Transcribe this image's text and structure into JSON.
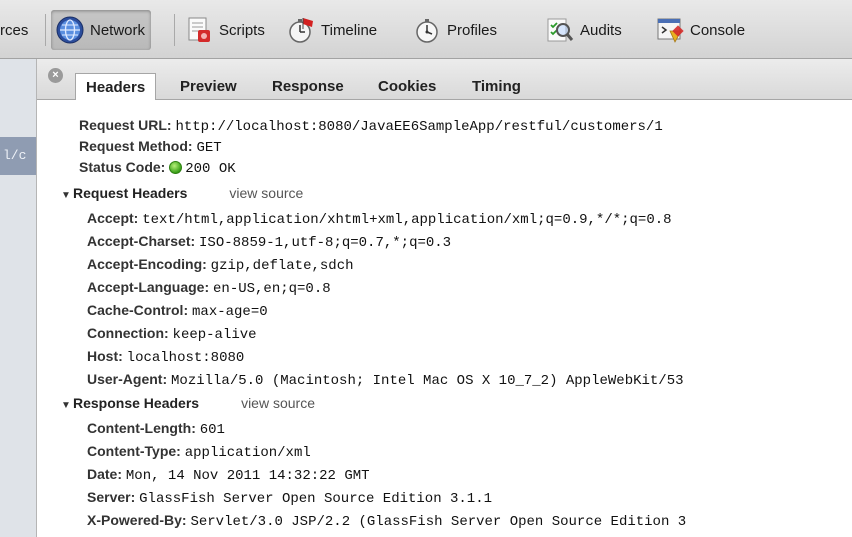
{
  "toolbar": {
    "items": [
      {
        "label": "rces",
        "icon": "resources-icon"
      },
      {
        "label": "Network",
        "icon": "network-globe-icon"
      },
      {
        "label": "Scripts",
        "icon": "scripts-icon"
      },
      {
        "label": "Timeline",
        "icon": "timeline-stopwatch-icon"
      },
      {
        "label": "Profiles",
        "icon": "profiles-stopwatch-icon"
      },
      {
        "label": "Audits",
        "icon": "audits-magnifier-icon"
      },
      {
        "label": "Console",
        "icon": "console-icon"
      }
    ],
    "selected": "Network"
  },
  "sidebar": {
    "selected_fragment": "l/c"
  },
  "tabs": {
    "close_glyph": "×",
    "items": [
      "Headers",
      "Preview",
      "Response",
      "Cookies",
      "Timing"
    ],
    "active": "Headers"
  },
  "general": {
    "request_url_key": "Request URL:",
    "request_url_val": "http://localhost:8080/JavaEE6SampleApp/restful/customers/1",
    "request_method_key": "Request Method:",
    "request_method_val": "GET",
    "status_code_key": "Status Code:",
    "status_code_val": "200 OK",
    "status_color": "#3aa018"
  },
  "request_headers": {
    "title": "Request Headers",
    "view_source": "view source",
    "rows": [
      {
        "key": "Accept:",
        "val": "text/html,application/xhtml+xml,application/xml;q=0.9,*/*;q=0.8"
      },
      {
        "key": "Accept-Charset:",
        "val": "ISO-8859-1,utf-8;q=0.7,*;q=0.3"
      },
      {
        "key": "Accept-Encoding:",
        "val": "gzip,deflate,sdch"
      },
      {
        "key": "Accept-Language:",
        "val": "en-US,en;q=0.8"
      },
      {
        "key": "Cache-Control:",
        "val": "max-age=0"
      },
      {
        "key": "Connection:",
        "val": "keep-alive"
      },
      {
        "key": "Host:",
        "val": "localhost:8080"
      },
      {
        "key": "User-Agent:",
        "val": "Mozilla/5.0 (Macintosh; Intel Mac OS X 10_7_2) AppleWebKit/53"
      }
    ]
  },
  "response_headers": {
    "title": "Response Headers",
    "view_source": "view source",
    "rows": [
      {
        "key": "Content-Length:",
        "val": "601"
      },
      {
        "key": "Content-Type:",
        "val": "application/xml"
      },
      {
        "key": "Date:",
        "val": "Mon, 14 Nov 2011 14:32:22 GMT"
      },
      {
        "key": "Server:",
        "val": "GlassFish Server Open Source Edition 3.1.1"
      },
      {
        "key": "X-Powered-By:",
        "val": "Servlet/3.0 JSP/2.2 (GlassFish Server Open Source Edition 3"
      }
    ]
  }
}
